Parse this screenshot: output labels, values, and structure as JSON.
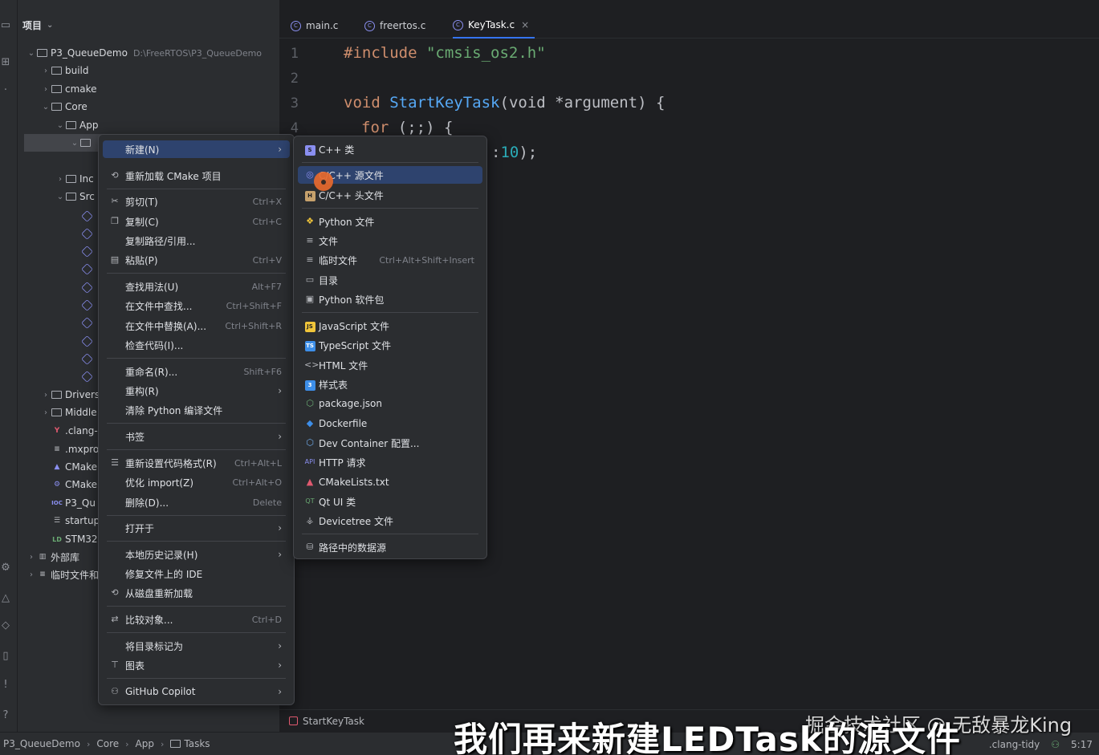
{
  "project_panel": {
    "header": "项目",
    "tree": [
      {
        "label": "P3_QueueDemo",
        "path": "D:\\FreeRTOS\\P3_QueueDemo"
      },
      {
        "label": "build"
      },
      {
        "label": "cmake"
      },
      {
        "label": "Core"
      },
      {
        "label": "App"
      },
      {
        "label": "Inc"
      },
      {
        "label": "Src"
      },
      {
        "label": "Drivers"
      },
      {
        "label": "Middle"
      },
      {
        "label": ".clang-"
      },
      {
        "label": ".mxpro"
      },
      {
        "label": "CMake"
      },
      {
        "label": "CMake"
      },
      {
        "label": "P3_Qu"
      },
      {
        "label": "startup"
      },
      {
        "label": "STM32"
      },
      {
        "label": "外部库"
      },
      {
        "label": "临时文件和"
      }
    ]
  },
  "tabs": [
    {
      "label": "main.c"
    },
    {
      "label": "freertos.c"
    },
    {
      "label": "KeyTask.c",
      "close": "×"
    }
  ],
  "editor": {
    "lines": [
      "1",
      "2",
      "3",
      "4"
    ],
    "code": {
      "l1_kw": "#include",
      "l1_str": "\"cmsis_os2.h\"",
      "l3_kw": "void",
      "l3_fn": "StartKeyTask",
      "l3_rest": "(void *argument) {",
      "l4_kw": "for",
      "l4_rest": " (;;) {",
      "l5_num": "10",
      "l5_rest": ");"
    }
  },
  "breadcrumb_func": "StartKeyTask",
  "context_menu": {
    "items": [
      {
        "label": "新建(N)",
        "submenu": "›"
      },
      {
        "label": "重新加载 CMake 项目"
      },
      {
        "label": "剪切(T)",
        "shortcut": "Ctrl+X"
      },
      {
        "label": "复制(C)",
        "shortcut": "Ctrl+C"
      },
      {
        "label": "复制路径/引用..."
      },
      {
        "label": "粘贴(P)",
        "shortcut": "Ctrl+V"
      },
      {
        "label": "查找用法(U)",
        "shortcut": "Alt+F7"
      },
      {
        "label": "在文件中查找...",
        "shortcut": "Ctrl+Shift+F"
      },
      {
        "label": "在文件中替换(A)...",
        "shortcut": "Ctrl+Shift+R"
      },
      {
        "label": "检查代码(I)..."
      },
      {
        "label": "重命名(R)...",
        "shortcut": "Shift+F6"
      },
      {
        "label": "重构(R)",
        "submenu": "›"
      },
      {
        "label": "清除 Python 编译文件"
      },
      {
        "label": "书签",
        "submenu": "›"
      },
      {
        "label": "重新设置代码格式(R)",
        "shortcut": "Ctrl+Alt+L"
      },
      {
        "label": "优化 import(Z)",
        "shortcut": "Ctrl+Alt+O"
      },
      {
        "label": "删除(D)...",
        "shortcut": "Delete"
      },
      {
        "label": "打开于",
        "submenu": "›"
      },
      {
        "label": "本地历史记录(H)",
        "submenu": "›"
      },
      {
        "label": "修复文件上的 IDE"
      },
      {
        "label": "从磁盘重新加载"
      },
      {
        "label": "比较对象...",
        "shortcut": "Ctrl+D"
      },
      {
        "label": "将目录标记为",
        "submenu": "›"
      },
      {
        "label": "图表",
        "submenu": "›"
      },
      {
        "label": "GitHub Copilot",
        "submenu": "›"
      }
    ]
  },
  "new_submenu": {
    "items": [
      {
        "label": "C++ 类"
      },
      {
        "label": "C/C++ 源文件"
      },
      {
        "label": "C/C++ 头文件"
      },
      {
        "label": "Python 文件"
      },
      {
        "label": "文件"
      },
      {
        "label": "临时文件",
        "shortcut": "Ctrl+Alt+Shift+Insert"
      },
      {
        "label": "目录"
      },
      {
        "label": "Python 软件包"
      },
      {
        "label": "JavaScript 文件"
      },
      {
        "label": "TypeScript 文件"
      },
      {
        "label": "HTML 文件"
      },
      {
        "label": "样式表"
      },
      {
        "label": "package.json"
      },
      {
        "label": "Dockerfile"
      },
      {
        "label": "Dev Container 配置..."
      },
      {
        "label": "HTTP 请求"
      },
      {
        "label": "CMakeLists.txt"
      },
      {
        "label": "Qt UI 类"
      },
      {
        "label": "Devicetree 文件"
      },
      {
        "label": "路径中的数据源"
      }
    ]
  },
  "status_bar": {
    "crumbs": [
      "P3_QueueDemo",
      "Core",
      "App",
      "Tasks"
    ],
    "right": [
      ".clang-tidy",
      "5:17"
    ]
  },
  "overlay": {
    "subtitle": "我们再来新建LEDTask的源文件",
    "watermark": "掘金技术社区 @ 无敌暴龙King"
  }
}
